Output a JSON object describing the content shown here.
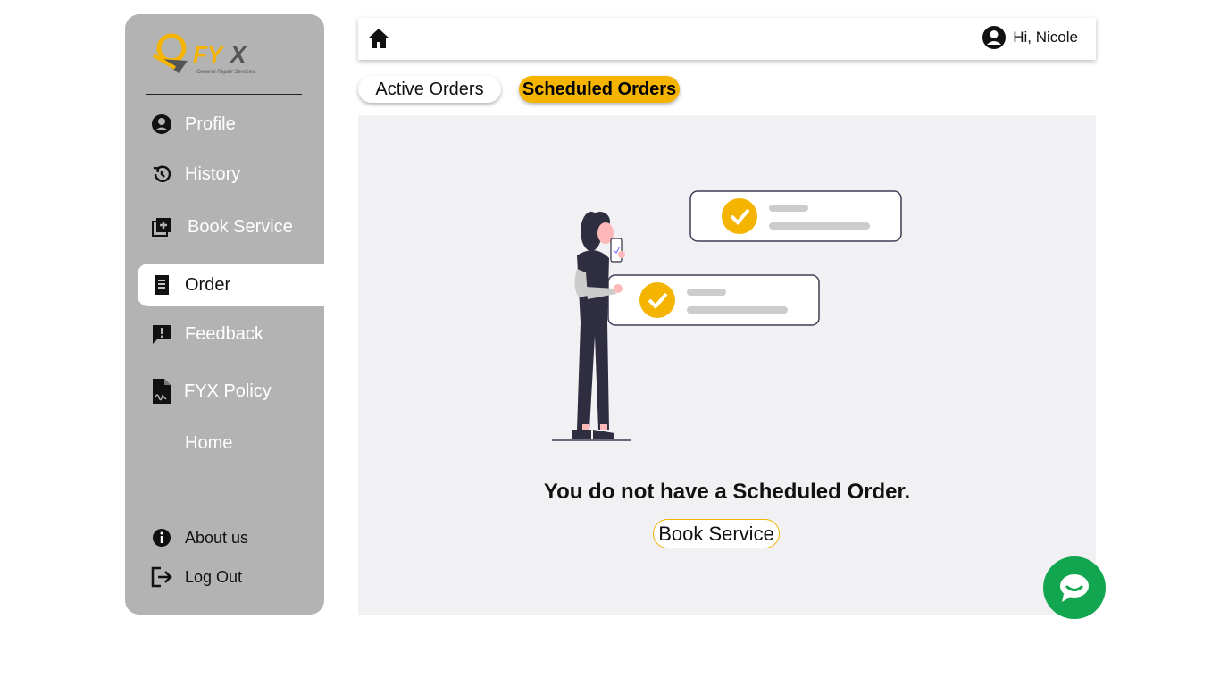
{
  "brand": {
    "logo_text": "FYX",
    "logo_tagline": "General Repair Services"
  },
  "sidebar": {
    "items": [
      {
        "label": "Profile",
        "icon": "user-circle-icon"
      },
      {
        "label": "History",
        "icon": "history-icon"
      },
      {
        "label": "Book Service",
        "icon": "add-library-icon"
      },
      {
        "label": "Order",
        "icon": "receipt-icon",
        "active": true
      },
      {
        "label": "Feedback",
        "icon": "feedback-icon"
      },
      {
        "label": "FYX Policy",
        "icon": "policy-document-icon"
      },
      {
        "label": "Home"
      }
    ],
    "bottom": [
      {
        "label": "About us",
        "icon": "info-icon"
      },
      {
        "label": "Log Out",
        "icon": "logout-icon"
      }
    ]
  },
  "header": {
    "greeting": "Hi, Nicole"
  },
  "tabs": {
    "active": "Active Orders",
    "scheduled": "Scheduled Orders"
  },
  "main": {
    "empty_message": "You do not have a Scheduled Order.",
    "book_button": "Book Service"
  },
  "colors": {
    "accent": "#f5b400",
    "sidebar": "#b3b3b3",
    "chat": "#12a650",
    "panel": "#f1f1f3"
  }
}
